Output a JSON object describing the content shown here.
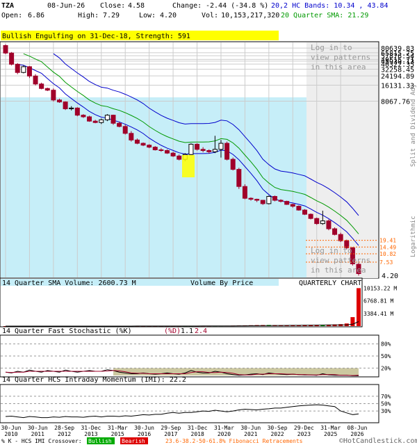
{
  "header": {
    "ticker": "TZA",
    "date": "08-Jun-26",
    "close_label": "Close:",
    "close": "4.58",
    "change_label": "Change:",
    "change": "-2.44 (-34.8 %)",
    "open_label": "Open:",
    "open": "6.86",
    "high_label": "High:",
    "high": "7.29",
    "low_label": "Low:",
    "low": "4.20",
    "vol_label": "Vol:",
    "vol": "10,153,217,320",
    "bands_text": "20,2 HC Bands: 10.34 , 43.84",
    "sma_text": "20 Quarter SMA: 21.29"
  },
  "pattern_banner": "Bullish Engulfing on 31-Dec-18, Strength: 591",
  "login_overlay_text": [
    "Log in to",
    "view patterns",
    "in this area"
  ],
  "side_labels": {
    "split": "Split and Dividend Adj",
    "log": "Logarithmic"
  },
  "colors": {
    "up": "#2E8B57",
    "down": "#A0002A",
    "sky": "#C6EEF8",
    "gray": "#EEEEEE",
    "upper_band": "#0000CC",
    "sma": "#009900",
    "lower_band": "#0000CC",
    "banner": "#FFFF00",
    "fib": "#FF6600",
    "vol_up": "#00AA00",
    "vol_down": "#DD0000",
    "stoch_band": "#CCC8A0"
  },
  "chart_data": [
    {
      "type": "candlestick",
      "title": "Price",
      "scale": "logarithmic",
      "y_tick_labels": [
        "80639.83",
        "65815.75",
        "57876.54",
        "49515.71",
        "45930.13",
        "40322.35",
        "32258.45",
        "24194.89",
        "16131.33",
        "8067.76"
      ],
      "y_tick_values": [
        80639.83,
        65815.75,
        57876.54,
        49515.71,
        45930.13,
        40322.35,
        32258.45,
        24194.89,
        16131.33,
        8067.76
      ],
      "fib_levels": [
        {
          "label": "19.41",
          "value": 19.41
        },
        {
          "label": "14.49",
          "value": 14.49
        },
        {
          "label": "10.82",
          "value": 10.82
        },
        {
          "label": "7.53",
          "value": 7.53
        }
      ],
      "last_price_label": "4.20",
      "x_labels": [
        "30-Jun 2010",
        "30-Jun 2011",
        "28-Sep 2012",
        "31-Dec 2013",
        "31-Mar 2015",
        "30-Jun 2016",
        "29-Sep 2017",
        "31-Dec 2018",
        "31-Mar 2020",
        "30-Jun 2021",
        "30-Sep 2022",
        "29-Dec 2023",
        "31-Mar 2025",
        "08-Jun 2026"
      ],
      "series": [
        {
          "name": "Quarterly candles (OHLC)",
          "values": [
            [
              90000,
              95000,
              62000,
              65000
            ],
            [
              65000,
              68000,
              38000,
              40000
            ],
            [
              40000,
              42000,
              26000,
              28000
            ],
            [
              28000,
              38000,
              27000,
              36000
            ],
            [
              36000,
              37000,
              22000,
              24000
            ],
            [
              24000,
              26000,
              16000,
              17000
            ],
            [
              17000,
              18000,
              13500,
              14000
            ],
            [
              14000,
              14500,
              12500,
              13000
            ],
            [
              13000,
              14000,
              8000,
              8500
            ],
            [
              8500,
              9000,
              7500,
              7800
            ],
            [
              7800,
              8000,
              5500,
              5800
            ],
            [
              5800,
              6500,
              5400,
              6000
            ],
            [
              6000,
              6200,
              4200,
              4400
            ],
            [
              4400,
              4600,
              3900,
              4100
            ],
            [
              4100,
              4300,
              3300,
              3400
            ],
            [
              3400,
              3600,
              3100,
              3200
            ],
            [
              3200,
              3800,
              3000,
              3600
            ],
            [
              3600,
              4600,
              3400,
              4400
            ],
            [
              4400,
              4500,
              2900,
              3100
            ],
            [
              3100,
              3300,
              2600,
              2700
            ],
            [
              2700,
              2900,
              1900,
              2000
            ],
            [
              2000,
              2200,
              1400,
              1500
            ],
            [
              1500,
              1600,
              1250,
              1300
            ],
            [
              1300,
              1350,
              1150,
              1200
            ],
            [
              1200,
              1250,
              1050,
              1100
            ],
            [
              1100,
              1150,
              950,
              980
            ],
            [
              980,
              1050,
              900,
              950
            ],
            [
              950,
              1000,
              820,
              850
            ],
            [
              850,
              900,
              720,
              750
            ],
            [
              750,
              800,
              620,
              650
            ],
            [
              650,
              850,
              600,
              800
            ],
            [
              800,
              1300,
              780,
              1250
            ],
            [
              1250,
              1300,
              950,
              1000
            ],
            [
              1000,
              1100,
              880,
              950
            ],
            [
              950,
              1000,
              830,
              900
            ],
            [
              900,
              1800,
              850,
              1000
            ],
            [
              1000,
              1500,
              700,
              1300
            ],
            [
              1300,
              1400,
              620,
              650
            ],
            [
              650,
              700,
              400,
              420
            ],
            [
              420,
              450,
              180,
              200
            ],
            [
              200,
              220,
              115,
              120
            ],
            [
              120,
              125,
              108,
              115
            ],
            [
              115,
              118,
              102,
              110
            ],
            [
              110,
              112,
              90,
              95
            ],
            [
              95,
              135,
              92,
              130
            ],
            [
              130,
              135,
              105,
              110
            ],
            [
              110,
              115,
              100,
              105
            ],
            [
              105,
              108,
              90,
              92
            ],
            [
              92,
              95,
              80,
              85
            ],
            [
              85,
              88,
              70,
              72
            ],
            [
              72,
              75,
              58,
              60
            ],
            [
              60,
              62,
              48,
              50
            ],
            [
              50,
              52,
              38,
              40
            ],
            [
              40,
              70,
              38,
              45
            ],
            [
              45,
              48,
              30,
              32
            ],
            [
              32,
              34,
              24,
              25
            ],
            [
              25,
              27,
              18,
              19
            ],
            [
              19,
              20,
              13,
              14
            ],
            [
              14,
              14.5,
              6.5,
              7.0
            ],
            [
              6.86,
              7.29,
              4.2,
              4.58
            ]
          ]
        },
        {
          "name": "Upper HC Band",
          "value_last": 43.84
        },
        {
          "name": "20 Quarter SMA",
          "value_last": 21.29
        },
        {
          "name": "Lower HC Band",
          "value_last": 10.34
        }
      ]
    },
    {
      "type": "bar",
      "title": "14 Quarter SMA Volume: 2600.73 M",
      "overlay_label": "Volume By Price",
      "right_label": "QUARTERLY CHART",
      "y_tick_labels": [
        "10153.22 M",
        "6768.81 M",
        "3384.41 M"
      ],
      "y_tick_values": [
        10153.22,
        6768.81,
        3384.41
      ],
      "series": [
        {
          "name": "Volume (M)",
          "values": [
            2,
            2,
            3,
            3,
            3,
            4,
            4,
            4,
            5,
            5,
            6,
            6,
            7,
            7,
            8,
            8,
            9,
            9,
            10,
            12,
            14,
            16,
            18,
            20,
            22,
            25,
            28,
            30,
            32,
            35,
            40,
            45,
            50,
            55,
            60,
            70,
            80,
            100,
            130,
            160,
            200,
            230,
            260,
            280,
            300,
            250,
            240,
            220,
            260,
            280,
            300,
            320,
            350,
            380,
            400,
            450,
            520,
            700,
            2400,
            10153
          ]
        },
        {
          "name": "14 Quarter SMA Volume",
          "value_last": 2600.73
        }
      ]
    },
    {
      "type": "line",
      "title": "14 Quarter Fast Stochastic (%K)",
      "legend_k": "(%K)",
      "legend_d": "(%D)",
      "value_k": "1.1",
      "value_d": "2.4",
      "y_tick_labels": [
        "80%",
        "50%",
        "20%"
      ],
      "y_tick_values": [
        80,
        50,
        20
      ],
      "series": [
        {
          "name": "%K",
          "values": [
            10,
            8,
            12,
            10,
            15,
            12,
            10,
            14,
            12,
            10,
            15,
            12,
            10,
            12,
            14,
            12,
            12,
            16,
            14,
            10,
            8,
            6,
            6,
            8,
            6,
            5,
            6,
            8,
            6,
            5,
            8,
            14,
            10,
            8,
            8,
            12,
            10,
            6,
            4,
            2,
            3,
            5,
            6,
            4,
            8,
            6,
            5,
            4,
            5,
            4,
            3,
            3,
            2,
            6,
            3,
            2,
            2,
            2,
            1,
            1.1
          ]
        },
        {
          "name": "%D",
          "values": [
            10,
            9,
            10,
            10,
            12,
            12,
            12,
            12,
            12,
            12,
            12,
            12,
            12,
            12,
            12,
            12,
            12,
            13,
            14,
            13,
            11,
            8,
            7,
            7,
            6,
            6,
            6,
            6,
            6,
            6,
            6,
            9,
            11,
            11,
            9,
            9,
            10,
            9,
            7,
            4,
            3,
            3,
            5,
            5,
            6,
            6,
            6,
            5,
            5,
            4,
            4,
            3,
            3,
            4,
            4,
            4,
            2,
            2,
            1.5,
            2.4
          ]
        }
      ]
    },
    {
      "type": "line",
      "title": "14 Quarter HCS Intraday Momentum (IMI): 22.2",
      "y_tick_labels": [
        "70%",
        "50%",
        "30%"
      ],
      "y_tick_values": [
        70,
        50,
        30
      ],
      "series": [
        {
          "name": "IMI",
          "values": [
            15,
            16,
            14,
            12,
            15,
            14,
            12,
            12,
            14,
            13,
            15,
            14,
            14,
            13,
            15,
            16,
            14,
            16,
            16,
            15,
            17,
            16,
            18,
            20,
            19,
            21,
            21,
            24,
            26,
            24,
            26,
            26,
            28,
            30,
            29,
            32,
            30,
            28,
            30,
            33,
            35,
            34,
            33,
            35,
            36,
            38,
            38,
            40,
            42,
            44,
            45,
            46,
            47,
            46,
            44,
            42,
            30,
            25,
            20,
            22.2
          ]
        }
      ]
    }
  ],
  "footer": {
    "legend_prefix": "% K - HCS IMI Crossover:",
    "bullish": "Bullish",
    "bearish": "Bearish",
    "fib_text": "23.6-38.2-50-61.8% Fibonacci Retracements",
    "copyright": "©HotCandlestick.com"
  }
}
